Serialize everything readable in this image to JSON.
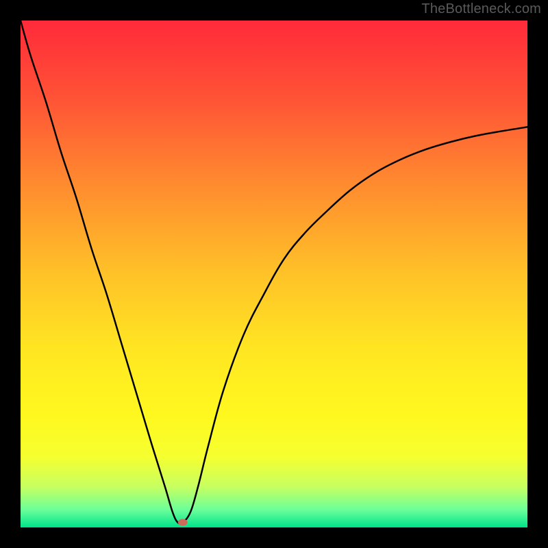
{
  "watermark": "TheBottleneck.com",
  "chart_data": {
    "type": "line",
    "title": "",
    "xlabel": "",
    "ylabel": "",
    "xlim": [
      0,
      100
    ],
    "ylim": [
      0,
      100
    ],
    "grid": false,
    "background_gradient": {
      "stops": [
        {
          "offset": 0.0,
          "color": "#ff2a3a"
        },
        {
          "offset": 0.15,
          "color": "#ff5236"
        },
        {
          "offset": 0.32,
          "color": "#ff8a2f"
        },
        {
          "offset": 0.5,
          "color": "#ffc228"
        },
        {
          "offset": 0.65,
          "color": "#ffe622"
        },
        {
          "offset": 0.78,
          "color": "#fff81f"
        },
        {
          "offset": 0.86,
          "color": "#f6ff30"
        },
        {
          "offset": 0.92,
          "color": "#c7ff60"
        },
        {
          "offset": 0.965,
          "color": "#6bff9a"
        },
        {
          "offset": 1.0,
          "color": "#00e28a"
        }
      ]
    },
    "series": [
      {
        "name": "curve",
        "x": [
          0,
          2,
          5,
          8,
          11,
          14,
          17,
          20,
          23,
          26,
          28.5,
          30,
          31,
          32,
          33.5,
          35,
          37,
          40,
          44,
          48,
          52,
          56,
          60,
          65,
          70,
          75,
          80,
          85,
          90,
          95,
          100
        ],
        "y": [
          100,
          93,
          84,
          74,
          65,
          55,
          46,
          36,
          26,
          16,
          8,
          3,
          1,
          1,
          3,
          8,
          16,
          27,
          38,
          46,
          53,
          58,
          62,
          66.5,
          70,
          72.6,
          74.6,
          76.1,
          77.3,
          78.2,
          79
        ]
      }
    ],
    "marker": {
      "x": 32,
      "y": 1,
      "color": "#cc6b5a",
      "rx": 7,
      "ry": 5
    }
  }
}
